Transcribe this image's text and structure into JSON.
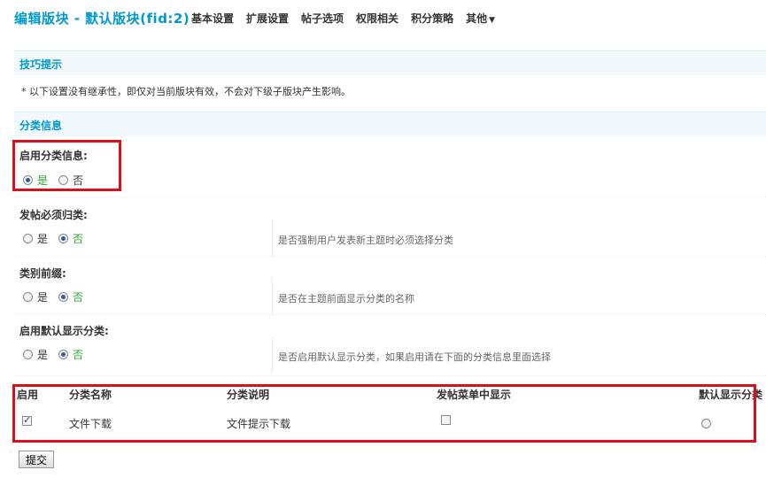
{
  "header": {
    "title": "编辑版块 - 默认版块(fid:2)",
    "nav": [
      "基本设置",
      "扩展设置",
      "帖子选项",
      "权限相关",
      "积分策略",
      "其他"
    ]
  },
  "tips": {
    "heading": "技巧提示",
    "text": "* 以下设置没有继承性，即仅对当前版块有效，不会对下级子版块产生影响。"
  },
  "category_info": {
    "heading": "分类信息",
    "settings": [
      {
        "label": "启用分类信息:",
        "yes": "是",
        "no": "否",
        "selected": "yes",
        "desc": ""
      },
      {
        "label": "发帖必须归类:",
        "yes": "是",
        "no": "否",
        "selected": "no",
        "desc": "是否强制用户发表新主题时必须选择分类"
      },
      {
        "label": "类别前缀:",
        "yes": "是",
        "no": "否",
        "selected": "no",
        "desc": "是否在主题前面显示分类的名称"
      },
      {
        "label": "启用默认显示分类:",
        "yes": "是",
        "no": "否",
        "selected": "no",
        "desc": "是否启用默认显示分类，如果启用请在下面的分类信息里面选择"
      }
    ]
  },
  "table": {
    "headers": [
      "启用",
      "分类名称",
      "分类说明",
      "发帖菜单中显示",
      "默认显示分类"
    ],
    "rows": [
      {
        "enabled": true,
        "name": "文件下载",
        "description": "文件提示下载",
        "show_in_menu": false,
        "default": false
      }
    ]
  },
  "submit_label": "提交",
  "colors": {
    "accent": "#0099cc",
    "highlight": "#d9101a",
    "active_option": "#2aa52a"
  }
}
